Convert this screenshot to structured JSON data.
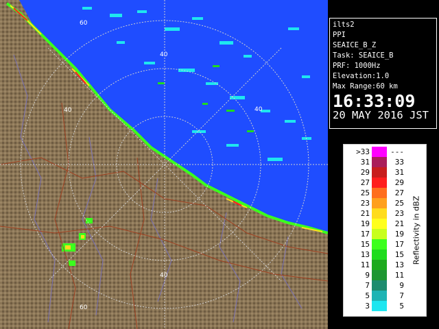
{
  "radar": {
    "ring_labels": [
      "60",
      "40",
      "40",
      "40",
      "40",
      "60"
    ],
    "colors": {
      "sea": "#1f4dff",
      "land": "#8a7555",
      "ring": "#d0d0d0",
      "rivers": "#7a72b5",
      "boundaries": "#a04020"
    }
  },
  "info": {
    "station": "ilts2",
    "mode": "PPI",
    "product": "SEAICE_B_Z",
    "task": "Task: SEAICE_B",
    "prf": "PRF: 1000Hz",
    "elevation": "Elevation:1.0",
    "max_range": "Max Range:60 km",
    "time": "16:33:09",
    "date": "20 MAY 2016 JST"
  },
  "legend": {
    "title": "Reflectivity in dBZ",
    "rows": [
      {
        "left": ">33",
        "right": "---",
        "color": "#ff00ff"
      },
      {
        "left": "31",
        "right": "33",
        "color": "#aa1e5a"
      },
      {
        "left": "29",
        "right": "31",
        "color": "#c81e1e"
      },
      {
        "left": "27",
        "right": "29",
        "color": "#ff1e1e"
      },
      {
        "left": "25",
        "right": "27",
        "color": "#ff6e1e"
      },
      {
        "left": "23",
        "right": "25",
        "color": "#ffa01e"
      },
      {
        "left": "21",
        "right": "23",
        "color": "#ffdc1e"
      },
      {
        "left": "19",
        "right": "21",
        "color": "#ffff1e"
      },
      {
        "left": "17",
        "right": "19",
        "color": "#c8ff1e"
      },
      {
        "left": "15",
        "right": "17",
        "color": "#3cff1e"
      },
      {
        "left": "13",
        "right": "15",
        "color": "#1edc1e"
      },
      {
        "left": "11",
        "right": "13",
        "color": "#1eaa1e"
      },
      {
        "left": "9",
        "right": "11",
        "color": "#1e9632"
      },
      {
        "left": "7",
        "right": "9",
        "color": "#1e8c6e"
      },
      {
        "left": "5",
        "right": "7",
        "color": "#1eb4b4"
      },
      {
        "left": "3",
        "right": "5",
        "color": "#1ee6f0"
      }
    ]
  }
}
